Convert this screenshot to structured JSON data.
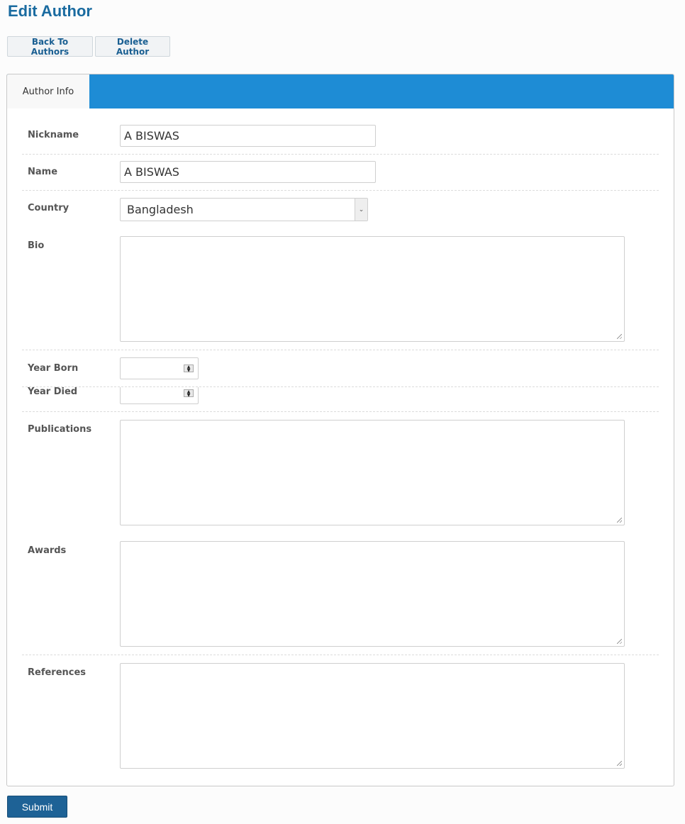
{
  "page": {
    "title": "Edit Author"
  },
  "toolbar": {
    "back_label": "Back To Authors",
    "delete_label": "Delete Author"
  },
  "tabs": [
    {
      "label": "Author Info",
      "active": true
    }
  ],
  "form": {
    "nickname": {
      "label": "Nickname",
      "value": "A BISWAS"
    },
    "name": {
      "label": "Name",
      "value": "A BISWAS"
    },
    "country": {
      "label": "Country",
      "selected": "Bangladesh"
    },
    "bio": {
      "label": "Bio",
      "value": ""
    },
    "year_born": {
      "label": "Year Born",
      "value": ""
    },
    "year_died": {
      "label": "Year Died",
      "value": ""
    },
    "publications": {
      "label": "Publications",
      "value": ""
    },
    "awards": {
      "label": "Awards",
      "value": ""
    },
    "references": {
      "label": "References",
      "value": ""
    }
  },
  "submit": {
    "label": "Submit"
  },
  "colors": {
    "accent": "#1e8cd5",
    "title": "#1a6ba0",
    "button": "#1e6296"
  },
  "icons": {
    "select_arrow": "chevron-down-icon",
    "spinner": "spinner-icon",
    "resize": "resize-grip-icon"
  }
}
